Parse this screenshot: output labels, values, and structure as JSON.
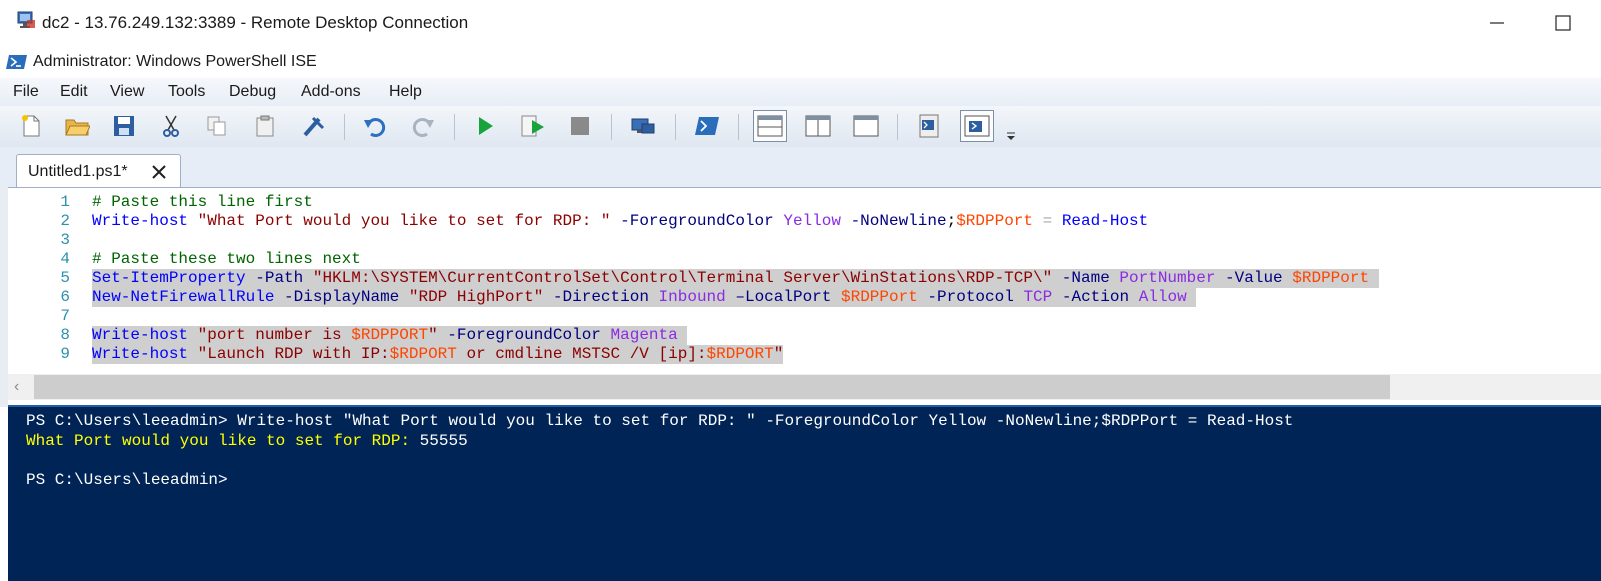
{
  "rdp": {
    "title": "dc2 - 13.76.249.132:3389 - Remote Desktop Connection"
  },
  "ise": {
    "title": "Administrator: Windows PowerShell ISE"
  },
  "menu": [
    "File",
    "Edit",
    "View",
    "Tools",
    "Debug",
    "Add-ons",
    "Help"
  ],
  "tab": {
    "label": "Untitled1.ps1*"
  },
  "editor": {
    "line_numbers": [
      "1",
      "2",
      "3",
      "4",
      "5",
      "6",
      "7",
      "8",
      "9"
    ],
    "lines": [
      [
        {
          "t": "# Paste this line first",
          "c": "com"
        }
      ],
      [
        {
          "t": "Write-host",
          "c": "cmd"
        },
        {
          "t": " ",
          "c": "plain"
        },
        {
          "t": "\"What Port would you like to set for RDP: \"",
          "c": "str"
        },
        {
          "t": " ",
          "c": "plain"
        },
        {
          "t": "-ForegroundColor",
          "c": "par"
        },
        {
          "t": " ",
          "c": "plain"
        },
        {
          "t": "Yellow",
          "c": "arg"
        },
        {
          "t": " ",
          "c": "plain"
        },
        {
          "t": "-NoNewline",
          "c": "par"
        },
        {
          "t": ";",
          "c": "plain"
        },
        {
          "t": "$RDPPort",
          "c": "var"
        },
        {
          "t": " ",
          "c": "plain"
        },
        {
          "t": "=",
          "c": "op"
        },
        {
          "t": " ",
          "c": "plain"
        },
        {
          "t": "Read-Host",
          "c": "cmd"
        }
      ],
      [],
      [
        {
          "t": "# Paste these two lines next",
          "c": "com"
        }
      ],
      [
        {
          "t": "Set-ItemProperty",
          "c": "cmd"
        },
        {
          "t": " ",
          "c": "plain"
        },
        {
          "t": "-Path",
          "c": "par"
        },
        {
          "t": " ",
          "c": "plain"
        },
        {
          "t": "\"HKLM:\\SYSTEM\\CurrentControlSet\\Control\\Terminal Server\\WinStations\\RDP-TCP\\\"",
          "c": "str"
        },
        {
          "t": " ",
          "c": "plain"
        },
        {
          "t": "-Name",
          "c": "par"
        },
        {
          "t": " ",
          "c": "plain"
        },
        {
          "t": "PortNumber",
          "c": "arg"
        },
        {
          "t": " ",
          "c": "plain"
        },
        {
          "t": "-Value",
          "c": "par"
        },
        {
          "t": " ",
          "c": "plain"
        },
        {
          "t": "$RDPPort",
          "c": "var"
        },
        {
          "t": " ",
          "c": "plain"
        }
      ],
      [
        {
          "t": "New-NetFirewallRule",
          "c": "cmd"
        },
        {
          "t": " ",
          "c": "plain"
        },
        {
          "t": "-DisplayName",
          "c": "par"
        },
        {
          "t": " ",
          "c": "plain"
        },
        {
          "t": "\"RDP HighPort\"",
          "c": "str"
        },
        {
          "t": " ",
          "c": "plain"
        },
        {
          "t": "-Direction",
          "c": "par"
        },
        {
          "t": " ",
          "c": "plain"
        },
        {
          "t": "Inbound",
          "c": "arg"
        },
        {
          "t": " ",
          "c": "plain"
        },
        {
          "t": "–LocalPort",
          "c": "par"
        },
        {
          "t": " ",
          "c": "plain"
        },
        {
          "t": "$RDPPort",
          "c": "var"
        },
        {
          "t": " ",
          "c": "plain"
        },
        {
          "t": "-Protocol",
          "c": "par"
        },
        {
          "t": " ",
          "c": "plain"
        },
        {
          "t": "TCP",
          "c": "arg"
        },
        {
          "t": " ",
          "c": "plain"
        },
        {
          "t": "-Action",
          "c": "par"
        },
        {
          "t": " ",
          "c": "plain"
        },
        {
          "t": "Allow",
          "c": "arg"
        },
        {
          "t": " ",
          "c": "plain"
        }
      ],
      [],
      [
        {
          "t": "Write-host",
          "c": "cmd"
        },
        {
          "t": " ",
          "c": "plain"
        },
        {
          "t": "\"port number is ",
          "c": "str"
        },
        {
          "t": "$RDPPORT",
          "c": "var"
        },
        {
          "t": "\"",
          "c": "str"
        },
        {
          "t": " ",
          "c": "plain"
        },
        {
          "t": "-ForegroundColor",
          "c": "par"
        },
        {
          "t": " ",
          "c": "plain"
        },
        {
          "t": "Magenta",
          "c": "arg"
        },
        {
          "t": " ",
          "c": "plain"
        }
      ],
      [
        {
          "t": "Write-host",
          "c": "cmd"
        },
        {
          "t": " ",
          "c": "plain"
        },
        {
          "t": "\"Launch RDP with IP:",
          "c": "str"
        },
        {
          "t": "$RDPORT",
          "c": "var"
        },
        {
          "t": " or cmdline MSTSC /V [ip]:",
          "c": "str"
        },
        {
          "t": "$RDPORT",
          "c": "var"
        },
        {
          "t": "\"",
          "c": "str"
        }
      ]
    ]
  },
  "console": {
    "lines": [
      {
        "text": "PS C:\\Users\\leeadmin> Write-host \"What Port would you like to set for RDP: \" -ForegroundColor Yellow -NoNewline;$RDPPort = Read-Host",
        "color": "#ffffff"
      },
      {
        "text": "What Port would you like to set for RDP: ",
        "color": "#ffff00",
        "suffix": "55555"
      },
      {
        "text": "",
        "color": "#ffffff"
      },
      {
        "text": "PS C:\\Users\\leeadmin>",
        "color": "#ffffff"
      }
    ]
  },
  "colors": {
    "comment": "#006400",
    "command": "#0000ff",
    "string": "#8b0000",
    "parameter": "#000080",
    "argument": "#8a2be2",
    "variable": "#ff4500",
    "console_bg": "#012456",
    "selection": "#cfcfcf"
  }
}
